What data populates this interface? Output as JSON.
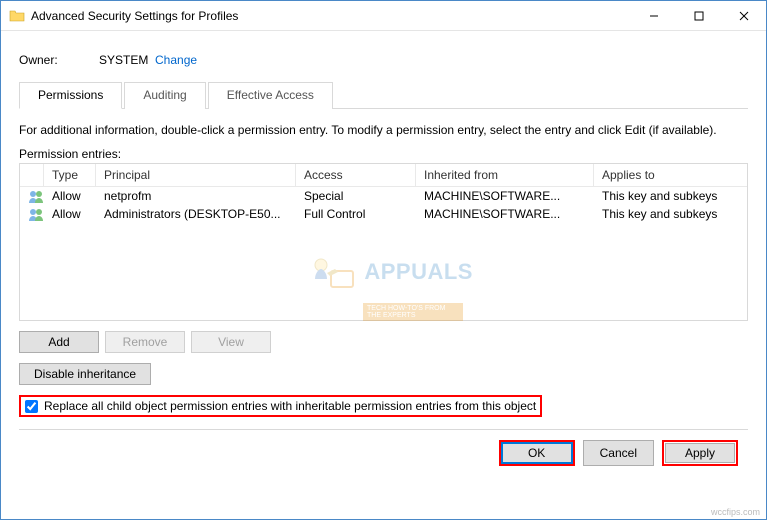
{
  "window": {
    "title": "Advanced Security Settings for Profiles"
  },
  "owner": {
    "label": "Owner:",
    "value": "SYSTEM",
    "change": "Change"
  },
  "tabs": {
    "permissions": "Permissions",
    "auditing": "Auditing",
    "effective": "Effective Access"
  },
  "info": "For additional information, double-click a permission entry. To modify a permission entry, select the entry and click Edit (if available).",
  "entries_label": "Permission entries:",
  "columns": {
    "type": "Type",
    "principal": "Principal",
    "access": "Access",
    "inherited": "Inherited from",
    "applies": "Applies to"
  },
  "rows": [
    {
      "type": "Allow",
      "principal": "netprofm",
      "access": "Special",
      "inherited": "MACHINE\\SOFTWARE...",
      "applies": "This key and subkeys"
    },
    {
      "type": "Allow",
      "principal": "Administrators (DESKTOP-E50...",
      "access": "Full Control",
      "inherited": "MACHINE\\SOFTWARE...",
      "applies": "This key and subkeys"
    }
  ],
  "buttons": {
    "add": "Add",
    "remove": "Remove",
    "view": "View",
    "disable_inherit": "Disable inheritance",
    "ok": "OK",
    "cancel": "Cancel",
    "apply": "Apply"
  },
  "checkbox_label": "Replace all child object permission entries with inheritable permission entries from this object",
  "watermark": {
    "brand": "APPUALS",
    "strip": "TECH HOW-TO'S FROM THE EXPERTS",
    "footer": "wccfips.com"
  }
}
